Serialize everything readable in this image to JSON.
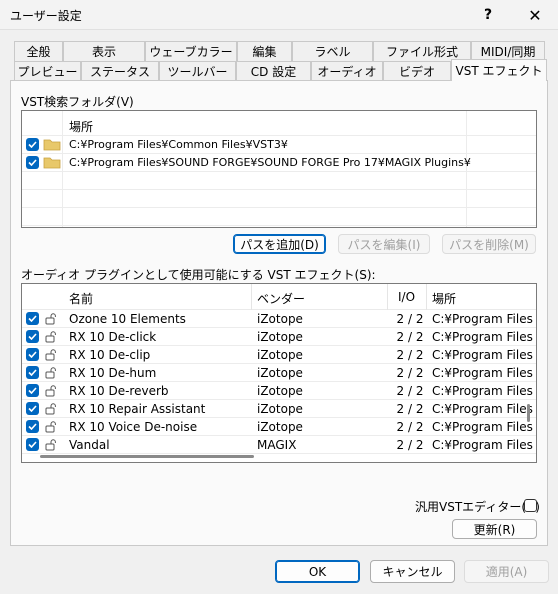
{
  "window": {
    "title": "ユーザー設定",
    "help_label": "?",
    "close_label": "✕"
  },
  "tabs_row1": [
    "全般",
    "表示",
    "ウェーブカラー",
    "編集",
    "ラベル",
    "ファイル形式",
    "MIDI/同期"
  ],
  "tabs_row2": [
    "プレビュー",
    "ステータス",
    "ツールバー",
    "CD 設定",
    "オーディオ",
    "ビデオ",
    "VST エフェクト"
  ],
  "active_tab": "VST エフェクト",
  "vst_folders": {
    "label": "VST検索フォルダ(V)",
    "column_header": "場所",
    "items": [
      {
        "checked": true,
        "path": "C:¥Program Files¥Common Files¥VST3¥"
      },
      {
        "checked": true,
        "path": "C:¥Program Files¥SOUND FORGE¥SOUND FORGE Pro 17¥MAGIX Plugins¥"
      }
    ]
  },
  "folder_buttons": {
    "add": "パスを追加(D)",
    "edit": "パスを編集(I)",
    "remove": "パスを削除(M)"
  },
  "plugins": {
    "label": "オーディオ プラグインとして使用可能にする VST エフェクト(S):",
    "columns": [
      "名前",
      "ベンダー",
      "I/O",
      "場所"
    ],
    "rows": [
      {
        "name": "Ozone 10 Elements",
        "vendor": "iZotope",
        "io": "2 / 2",
        "location": "C:¥Program Files"
      },
      {
        "name": "RX 10 De-click",
        "vendor": "iZotope",
        "io": "2 / 2",
        "location": "C:¥Program Files"
      },
      {
        "name": "RX 10 De-clip",
        "vendor": "iZotope",
        "io": "2 / 2",
        "location": "C:¥Program Files"
      },
      {
        "name": "RX 10 De-hum",
        "vendor": "iZotope",
        "io": "2 / 2",
        "location": "C:¥Program Files"
      },
      {
        "name": "RX 10 De-reverb",
        "vendor": "iZotope",
        "io": "2 / 2",
        "location": "C:¥Program Files"
      },
      {
        "name": "RX 10 Repair Assistant",
        "vendor": "iZotope",
        "io": "2 / 2",
        "location": "C:¥Program Files"
      },
      {
        "name": "RX 10 Voice De-noise",
        "vendor": "iZotope",
        "io": "2 / 2",
        "location": "C:¥Program Files"
      },
      {
        "name": "Vandal",
        "vendor": "MAGIX",
        "io": "2 / 2",
        "location": "C:¥Program Files"
      }
    ]
  },
  "generic_editor_label": "汎用VSTエディター(G)",
  "refresh_button": "更新(R)",
  "footer": {
    "ok": "OK",
    "cancel": "キャンセル",
    "apply": "適用(A)"
  },
  "colors": {
    "accent": "#0067c0",
    "folder": "#e8c86a"
  }
}
